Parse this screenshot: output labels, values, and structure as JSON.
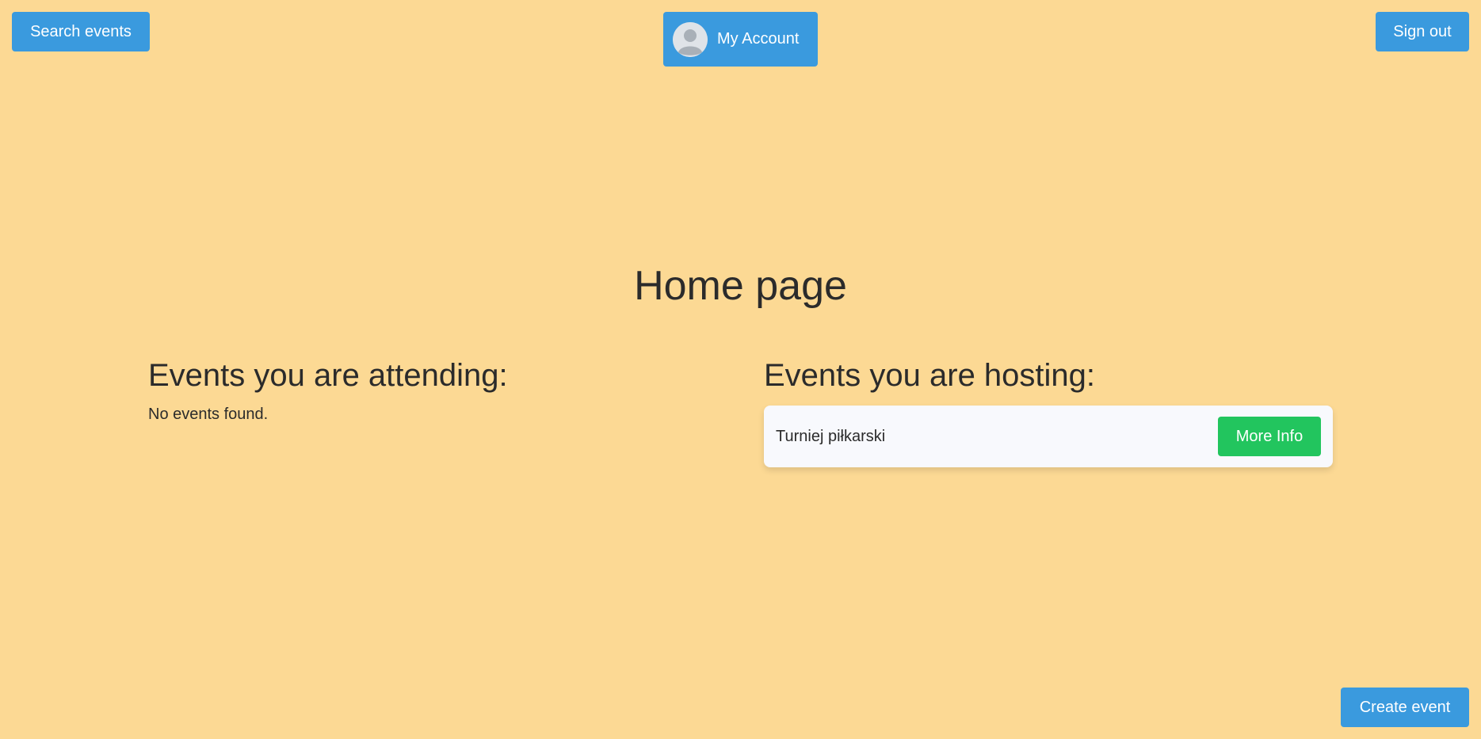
{
  "header": {
    "search_label": "Search events",
    "account_label": "My Account",
    "signout_label": "Sign out"
  },
  "main": {
    "title": "Home page",
    "attending": {
      "heading": "Events you are attending:",
      "empty_text": "No events found."
    },
    "hosting": {
      "heading": "Events you are hosting:",
      "events": [
        {
          "name": "Turniej piłkarski",
          "action_label": "More Info"
        }
      ]
    }
  },
  "footer": {
    "create_label": "Create event"
  },
  "icons": {
    "avatar": "user-avatar-icon"
  },
  "colors": {
    "background": "#fcd994",
    "primary_button": "#3a9ade",
    "success_button": "#22c55e",
    "card": "#f8f9fd"
  }
}
